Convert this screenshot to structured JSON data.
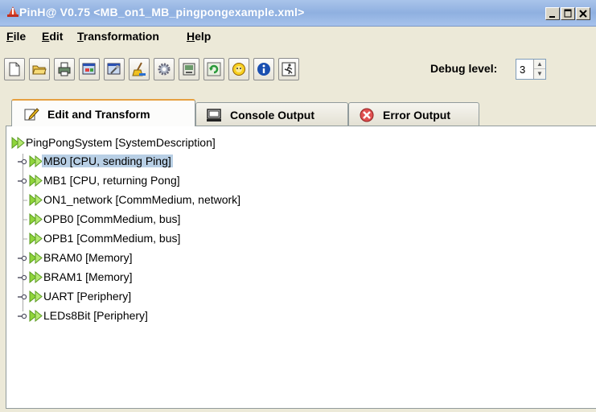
{
  "window": {
    "title": "PinH@ V0.75 <MB_on1_MB_pingpongexample.xml>"
  },
  "menu": [
    "File",
    "Edit",
    "Transformation",
    "Help"
  ],
  "toolbar": {
    "buttons": [
      "new-icon",
      "open-icon",
      "print-icon",
      "properties-icon",
      "tools-icon",
      "clean-icon",
      "gear-icon",
      "export-icon",
      "refresh-icon",
      "smiley-icon",
      "info-icon",
      "run-icon"
    ],
    "debug_label": "Debug level:",
    "debug_value": "3"
  },
  "tabs": [
    {
      "label": "Edit and Transform",
      "icon": "edit-icon",
      "active": true
    },
    {
      "label": "Console Output",
      "icon": "console-icon",
      "active": false
    },
    {
      "label": "Error Output",
      "icon": "error-icon",
      "active": false
    }
  ],
  "tree": {
    "root": "PingPongSystem [SystemDescription]",
    "children": [
      {
        "label": "MB0 [CPU, sending Ping]",
        "expandable": true,
        "selected": true
      },
      {
        "label": "MB1 [CPU, returning Pong]",
        "expandable": true,
        "selected": false
      },
      {
        "label": "ON1_network [CommMedium, network]",
        "expandable": false,
        "selected": false
      },
      {
        "label": "OPB0 [CommMedium, bus]",
        "expandable": false,
        "selected": false
      },
      {
        "label": "OPB1 [CommMedium, bus]",
        "expandable": false,
        "selected": false
      },
      {
        "label": "BRAM0 [Memory]",
        "expandable": true,
        "selected": false
      },
      {
        "label": "BRAM1 [Memory]",
        "expandable": true,
        "selected": false
      },
      {
        "label": "UART [Periphery]",
        "expandable": true,
        "selected": false
      },
      {
        "label": "LEDs8Bit [Periphery]",
        "expandable": true,
        "selected": false
      }
    ]
  },
  "colors": {
    "node_icon": "#8ed43a",
    "selection": "#b8cfe5",
    "active_tab_accent": "#e6a040"
  }
}
